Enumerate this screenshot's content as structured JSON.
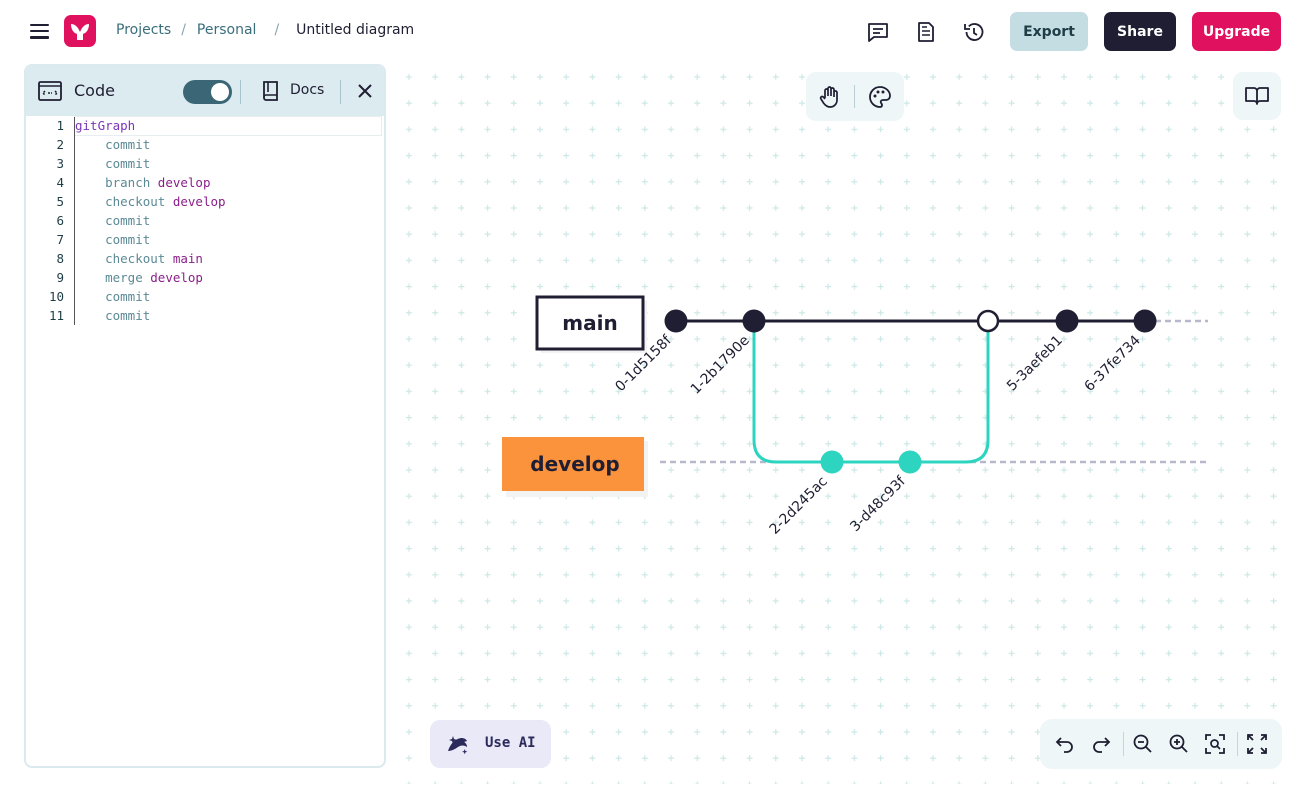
{
  "header": {
    "breadcrumbs": [
      "Projects",
      "Personal"
    ],
    "current": "Untitled diagram",
    "export_label": "Export",
    "share_label": "Share",
    "upgrade_label": "Upgrade"
  },
  "panel": {
    "title": "Code",
    "docs_label": "Docs",
    "toggle_on": true
  },
  "code": [
    {
      "n": "1",
      "kw": "gitGraph",
      "arg": ""
    },
    {
      "n": "2",
      "kw": "    commit",
      "arg": ""
    },
    {
      "n": "3",
      "kw": "    commit",
      "arg": ""
    },
    {
      "n": "4",
      "kw": "    branch ",
      "arg": "develop"
    },
    {
      "n": "5",
      "kw": "    checkout ",
      "arg": "develop"
    },
    {
      "n": "6",
      "kw": "    commit",
      "arg": ""
    },
    {
      "n": "7",
      "kw": "    commit",
      "arg": ""
    },
    {
      "n": "8",
      "kw": "    checkout ",
      "arg": "main"
    },
    {
      "n": "9",
      "kw": "    merge ",
      "arg": "develop"
    },
    {
      "n": "10",
      "kw": "    commit",
      "arg": ""
    },
    {
      "n": "11",
      "kw": "    commit",
      "arg": ""
    }
  ],
  "graph": {
    "branches": [
      {
        "name": "main",
        "color": "#1f1e33",
        "fill": "#ffffff"
      },
      {
        "name": "develop",
        "color": "#2dd4bf",
        "fill": "#fb923c"
      }
    ],
    "commits": [
      {
        "id": "0-1d5158f",
        "branch": "main"
      },
      {
        "id": "1-2b1790e",
        "branch": "main"
      },
      {
        "id": "2-2d245ac",
        "branch": "develop"
      },
      {
        "id": "3-d48c93f",
        "branch": "develop"
      },
      {
        "id": "",
        "branch": "main",
        "merge": true
      },
      {
        "id": "5-3aefeb1",
        "branch": "main"
      },
      {
        "id": "6-37fe734",
        "branch": "main"
      }
    ]
  },
  "ai": {
    "label": "Use AI"
  },
  "icons": {
    "menu": "menu-icon",
    "logo": "mermaid-logo",
    "comments": "comment-icon",
    "notes": "document-icon",
    "history": "history-icon",
    "code": "code-icon",
    "docs": "book-icon",
    "close": "close-icon",
    "hand": "hand-icon",
    "palette": "palette-icon",
    "undo": "undo-icon",
    "redo": "redo-icon",
    "zoom_out": "zoom-out-icon",
    "zoom_in": "zoom-in-icon",
    "fit": "fit-icon",
    "fullscreen": "fullscreen-icon"
  }
}
